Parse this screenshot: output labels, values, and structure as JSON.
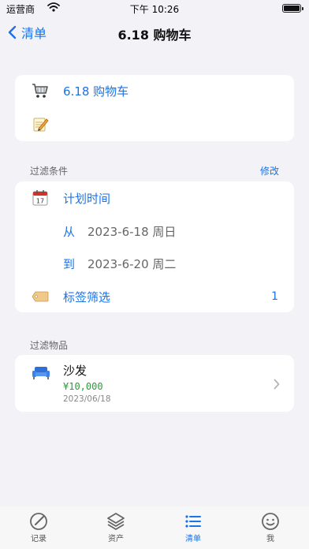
{
  "status_bar": {
    "carrier": "运营商",
    "time": "下午 10:26"
  },
  "nav": {
    "back_label": "清单",
    "title": "6.18 购物车"
  },
  "list_info": {
    "name": "6.18 购物车",
    "note": "",
    "name_icon": "cart-icon",
    "note_icon": "memo-icon"
  },
  "filter": {
    "section_title": "过滤条件",
    "edit_label": "修改",
    "plan_time_label": "计划时间",
    "from_label": "从",
    "from_value": "2023-6-18 周日",
    "to_label": "到",
    "to_value": "2023-6-20 周二",
    "tag_label": "标签筛选",
    "tag_count": "1"
  },
  "items": {
    "section_title": "过滤物品",
    "list": [
      {
        "name": "沙发",
        "price": "¥10,000",
        "date": "2023/06/18",
        "icon": "sofa-icon"
      }
    ]
  },
  "tabs": [
    {
      "label": "记录",
      "icon": "pencil-circle-icon",
      "active": false
    },
    {
      "label": "资产",
      "icon": "layers-icon",
      "active": false
    },
    {
      "label": "清单",
      "icon": "list-icon",
      "active": true
    },
    {
      "label": "我",
      "icon": "smiley-icon",
      "active": false
    }
  ],
  "colors": {
    "accent": "#1a73e8",
    "price_green": "#2e9a3a",
    "background": "#f2f2f7"
  }
}
